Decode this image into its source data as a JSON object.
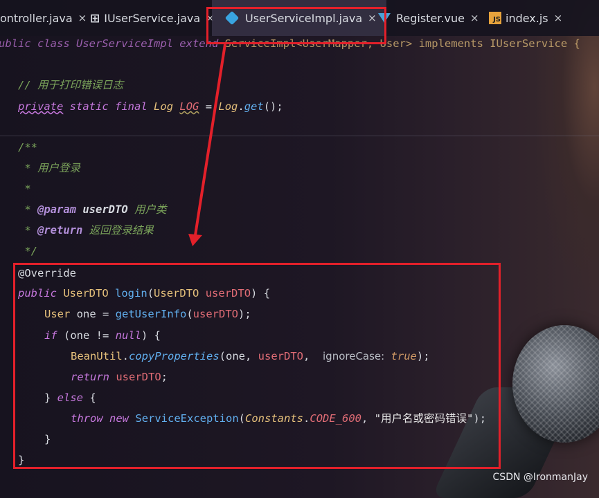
{
  "tabs": [
    {
      "label": "ontroller.java",
      "icon": "none",
      "close": "×"
    },
    {
      "label": "IUserService.java",
      "icon": "interface-icon",
      "close": "×"
    },
    {
      "label": "UserServiceImpl.java",
      "icon": "class-icon",
      "close": "×",
      "active": true
    },
    {
      "label": "Register.vue",
      "icon": "vue-icon",
      "close": "×"
    },
    {
      "label": "index.js",
      "icon": "js-icon",
      "close": "×"
    }
  ],
  "js_badge": "JS",
  "code": {
    "l0_a": "ublic class UserServiceImpl extend",
    "l0_b": "ServiceImpl<UserMapper, User> implements IUserService {",
    "l1": "// 用于打印错误日志",
    "l2_private": "private",
    "l2_static": "static",
    "l2_final": "final",
    "l2_type": "Log",
    "l2_name": "LOG",
    "l2_eq": " = ",
    "l2_cls": "Log",
    "l2_dot": ".",
    "l2_get": "get",
    "l2_end": "();",
    "d0": "/**",
    "d1": " * 用户登录",
    "d2": " *",
    "d3_star": " * ",
    "d3_tag": "@param",
    "d3_name": "userDTO",
    "d3_desc": "用户类",
    "d4_star": " * ",
    "d4_tag": "@return",
    "d4_desc": "返回登录结果",
    "d5": " */",
    "c0": "@Override",
    "c1_public": "public",
    "c1_type": "UserDTO",
    "c1_fn": "login",
    "c1_p1": "(",
    "c1_ptype": "UserDTO",
    "c1_pname": "userDTO",
    "c1_p2": ") {",
    "c2_type": "User",
    "c2_var": "one",
    "c2_eq": " = ",
    "c2_fn": "getUserInfo",
    "c2_p1": "(",
    "c2_arg": "userDTO",
    "c2_p2": ");",
    "c3_if": "if",
    "c3_cond1": " (one != ",
    "c3_null": "null",
    "c3_cond2": ") {",
    "c4_cls": "BeanUtil",
    "c4_dot": ".",
    "c4_fn": "copyProperties",
    "c4_p1": "(one, ",
    "c4_arg": "userDTO",
    "c4_comma": ",",
    "c4_hint": "ignoreCase:",
    "c4_true": "true",
    "c4_end": ");",
    "c5_return": "return",
    "c5_val": "userDTO",
    "c5_end": ";",
    "c6_brace": "} ",
    "c6_else": "else",
    "c6_open": " {",
    "c7_throw": "throw",
    "c7_new": "new",
    "c7_cls": "ServiceException",
    "c7_p1": "(",
    "c7_const_cls": "Constants",
    "c7_dot": ".",
    "c7_const": "CODE_600",
    "c7_comma": ", ",
    "c7_str": "\"用户名或密码错误\"",
    "c7_end": ");",
    "c8": "}",
    "c9": "}"
  },
  "watermark": "CSDN @IronmanJay",
  "annotation_color": "#e3202a"
}
